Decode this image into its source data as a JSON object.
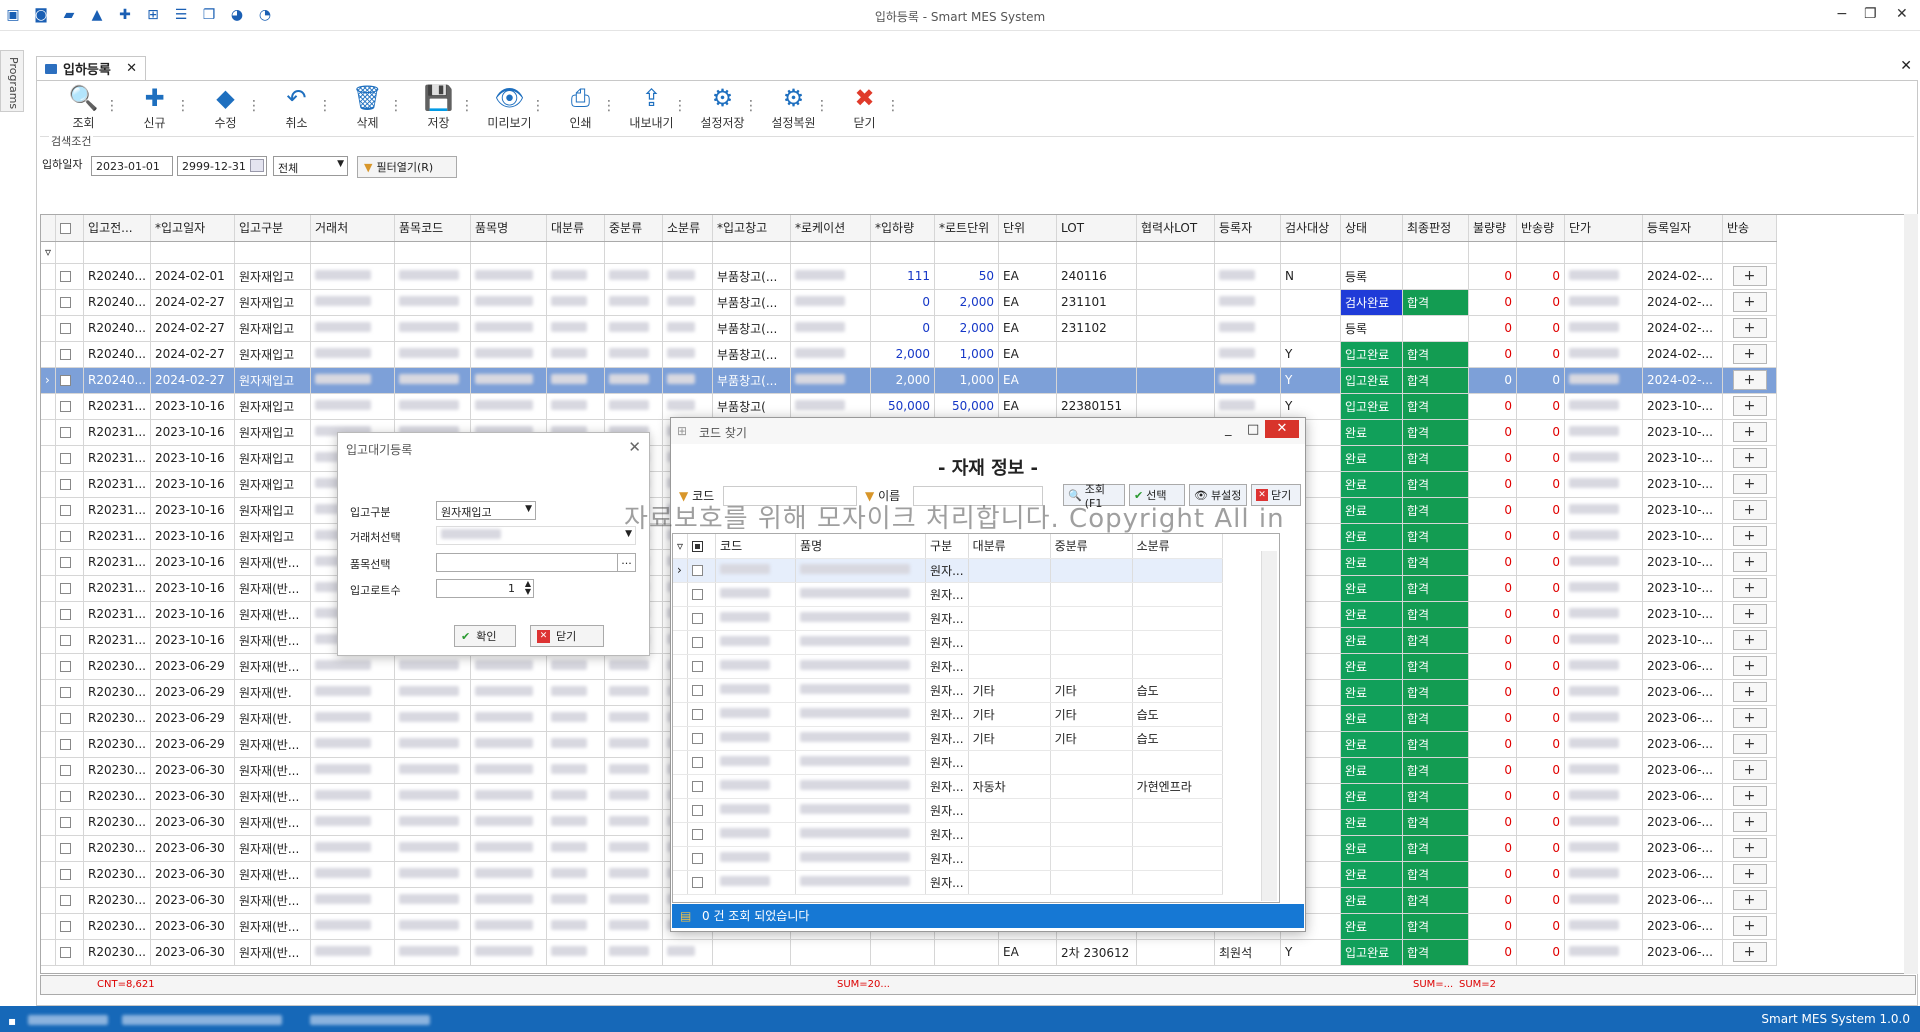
{
  "window": {
    "title": "입하등록 - Smart MES System"
  },
  "quick_icons": [
    "monitor-icon",
    "camera-icon",
    "folder-icon",
    "lock-icon",
    "add-circle-icon",
    "hierarchy-icon",
    "list-icon",
    "window-icon",
    "palette-icon",
    "palette-icon"
  ],
  "sidebar": {
    "label": "Programs"
  },
  "tab": {
    "label": "입하등록"
  },
  "toolbar": [
    {
      "label": "조회",
      "icon": "search-icon"
    },
    {
      "label": "신규",
      "icon": "new-icon"
    },
    {
      "label": "수정",
      "icon": "eraser-icon"
    },
    {
      "label": "취소",
      "icon": "undo-icon"
    },
    {
      "label": "삭제",
      "icon": "trash-icon"
    },
    {
      "label": "저장",
      "icon": "save-icon"
    },
    {
      "label": "미리보기",
      "icon": "eye-icon"
    },
    {
      "label": "인쇄",
      "icon": "print-icon"
    },
    {
      "label": "내보내기",
      "icon": "export-icon"
    },
    {
      "label": "설정저장",
      "icon": "gear-icon"
    },
    {
      "label": "설정복원",
      "icon": "gear-restore-icon"
    },
    {
      "label": "닫기",
      "icon": "close-icon"
    }
  ],
  "filter": {
    "legend": "검색조건",
    "date_label": "입하일자",
    "date_from": "2023-01-01",
    "date_to": "2999-12-31",
    "type_value": "전체",
    "filter_button": "필터열기(R)"
  },
  "grid": {
    "columns": [
      "",
      "입고전...",
      "*입고일자",
      "입고구분",
      "거래처",
      "품목코드",
      "품목명",
      "대분류",
      "중분류",
      "소분류",
      "*입고창고",
      "*로케이션",
      "*입하량",
      "*로트단위",
      "단위",
      "LOT",
      "협력사LOT",
      "등록자",
      "검사대상",
      "상태",
      "최종판정",
      "불량량",
      "반송량",
      "단가",
      "등록일자",
      "반송"
    ],
    "rows": [
      {
        "no": "R20240...",
        "date": "2024-02-01",
        "type": "원자재입고",
        "wh": "부품창고(...",
        "qty": "111",
        "lot_unit": "50",
        "unit": "EA",
        "lot": "240116",
        "insp": "N",
        "status": "등록",
        "judge": "",
        "bad": "0",
        "ret": "0",
        "reg": "2024-02-..."
      },
      {
        "no": "R20240...",
        "date": "2024-02-27",
        "type": "원자재입고",
        "wh": "부품창고(...",
        "qty": "0",
        "lot_unit": "2,000",
        "unit": "EA",
        "lot": "231101",
        "insp": "",
        "status": "검사완료",
        "judge": "합격",
        "bad": "0",
        "ret": "0",
        "reg": "2024-02-..."
      },
      {
        "no": "R20240...",
        "date": "2024-02-27",
        "type": "원자재입고",
        "wh": "부품창고(...",
        "qty": "0",
        "lot_unit": "2,000",
        "unit": "EA",
        "lot": "231102",
        "insp": "",
        "status": "등록",
        "judge": "",
        "bad": "0",
        "ret": "0",
        "reg": "2024-02-..."
      },
      {
        "no": "R20240...",
        "date": "2024-02-27",
        "type": "원자재입고",
        "wh": "부품창고(...",
        "qty": "2,000",
        "lot_unit": "1,000",
        "unit": "EA",
        "lot": "",
        "insp": "Y",
        "status": "입고완료",
        "judge": "합격",
        "bad": "0",
        "ret": "0",
        "reg": "2024-02-..."
      },
      {
        "no": "R20240...",
        "date": "2024-02-27",
        "type": "원자재입고",
        "wh": "부품창고(...",
        "qty": "2,000",
        "lot_unit": "1,000",
        "unit": "EA",
        "lot": "",
        "insp": "Y",
        "status": "입고완료",
        "judge": "합격",
        "bad": "0",
        "ret": "0",
        "reg": "2024-02-...",
        "selected": true
      },
      {
        "no": "R20231...",
        "date": "2023-10-16",
        "type": "원자재입고",
        "wh": "부품창고(",
        "qty": "50,000",
        "lot_unit": "50,000",
        "unit": "EA",
        "lot": "22380151",
        "insp": "Y",
        "status": "입고완료",
        "judge": "합격",
        "bad": "0",
        "ret": "0",
        "reg": "2023-10-..."
      },
      {
        "no": "R20231...",
        "date": "2023-10-16",
        "type": "원자재입고",
        "wh": "",
        "qty": "",
        "lot_unit": "",
        "unit": "",
        "lot": "",
        "insp": "",
        "status": "완료",
        "judge": "합격",
        "bad": "0",
        "ret": "0",
        "reg": "2023-10-..."
      },
      {
        "no": "R20231...",
        "date": "2023-10-16",
        "type": "원자재입고",
        "wh": "",
        "qty": "",
        "lot_unit": "",
        "unit": "",
        "lot": "",
        "insp": "",
        "status": "완료",
        "judge": "합격",
        "bad": "0",
        "ret": "0",
        "reg": "2023-10-..."
      },
      {
        "no": "R20231...",
        "date": "2023-10-16",
        "type": "원자재입고",
        "wh": "",
        "qty": "",
        "lot_unit": "",
        "unit": "",
        "lot": "",
        "insp": "",
        "status": "완료",
        "judge": "합격",
        "bad": "0",
        "ret": "0",
        "reg": "2023-10-..."
      },
      {
        "no": "R20231...",
        "date": "2023-10-16",
        "type": "원자재입고",
        "wh": "",
        "qty": "",
        "lot_unit": "",
        "unit": "",
        "lot": "",
        "insp": "",
        "status": "완료",
        "judge": "합격",
        "bad": "0",
        "ret": "0",
        "reg": "2023-10-..."
      },
      {
        "no": "R20231...",
        "date": "2023-10-16",
        "type": "원자재입고",
        "wh": "",
        "qty": "",
        "lot_unit": "",
        "unit": "",
        "lot": "",
        "insp": "",
        "status": "완료",
        "judge": "합격",
        "bad": "0",
        "ret": "0",
        "reg": "2023-10-..."
      },
      {
        "no": "R20231...",
        "date": "2023-10-16",
        "type": "원자재(반...",
        "wh": "",
        "qty": "",
        "lot_unit": "",
        "unit": "",
        "lot": "",
        "insp": "",
        "status": "완료",
        "judge": "합격",
        "bad": "0",
        "ret": "0",
        "reg": "2023-10-..."
      },
      {
        "no": "R20231...",
        "date": "2023-10-16",
        "type": "원자재(반...",
        "wh": "",
        "qty": "",
        "lot_unit": "",
        "unit": "",
        "lot": "",
        "insp": "",
        "status": "완료",
        "judge": "합격",
        "bad": "0",
        "ret": "0",
        "reg": "2023-10-..."
      },
      {
        "no": "R20231...",
        "date": "2023-10-16",
        "type": "원자재(반...",
        "wh": "",
        "qty": "",
        "lot_unit": "",
        "unit": "",
        "lot": "",
        "insp": "",
        "status": "완료",
        "judge": "합격",
        "bad": "0",
        "ret": "0",
        "reg": "2023-10-..."
      },
      {
        "no": "R20231...",
        "date": "2023-10-16",
        "type": "원자재(반...",
        "wh": "",
        "qty": "",
        "lot_unit": "",
        "unit": "",
        "lot": "",
        "insp": "",
        "status": "완료",
        "judge": "합격",
        "bad": "0",
        "ret": "0",
        "reg": "2023-10-..."
      },
      {
        "no": "R20230...",
        "date": "2023-06-29",
        "type": "원자재(반...",
        "wh": "",
        "qty": "",
        "lot_unit": "",
        "unit": "",
        "lot": "",
        "insp": "",
        "status": "완료",
        "judge": "합격",
        "bad": "0",
        "ret": "0",
        "reg": "2023-06-..."
      },
      {
        "no": "R20230...",
        "date": "2023-06-29",
        "type": "원자재(반.",
        "wh": "",
        "qty": "",
        "lot_unit": "",
        "unit": "",
        "lot": "",
        "insp": "",
        "status": "완료",
        "judge": "합격",
        "bad": "0",
        "ret": "0",
        "reg": "2023-06-..."
      },
      {
        "no": "R20230...",
        "date": "2023-06-29",
        "type": "원자재(반.",
        "wh": "",
        "qty": "",
        "lot_unit": "",
        "unit": "",
        "lot": "",
        "insp": "",
        "status": "완료",
        "judge": "합격",
        "bad": "0",
        "ret": "0",
        "reg": "2023-06-..."
      },
      {
        "no": "R20230...",
        "date": "2023-06-29",
        "type": "원자재(반...",
        "wh": "",
        "qty": "",
        "lot_unit": "",
        "unit": "",
        "lot": "",
        "insp": "",
        "status": "완료",
        "judge": "합격",
        "bad": "0",
        "ret": "0",
        "reg": "2023-06-..."
      },
      {
        "no": "R20230...",
        "date": "2023-06-30",
        "type": "원자재(반...",
        "wh": "",
        "qty": "",
        "lot_unit": "",
        "unit": "",
        "lot": "",
        "insp": "",
        "status": "완료",
        "judge": "합격",
        "bad": "0",
        "ret": "0",
        "reg": "2023-06-..."
      },
      {
        "no": "R20230...",
        "date": "2023-06-30",
        "type": "원자재(반...",
        "wh": "",
        "qty": "",
        "lot_unit": "",
        "unit": "",
        "lot": "",
        "insp": "",
        "status": "완료",
        "judge": "합격",
        "bad": "0",
        "ret": "0",
        "reg": "2023-06-..."
      },
      {
        "no": "R20230...",
        "date": "2023-06-30",
        "type": "원자재(반...",
        "wh": "",
        "qty": "",
        "lot_unit": "",
        "unit": "",
        "lot": "",
        "insp": "",
        "status": "완료",
        "judge": "합격",
        "bad": "0",
        "ret": "0",
        "reg": "2023-06-..."
      },
      {
        "no": "R20230...",
        "date": "2023-06-30",
        "type": "원자재(반...",
        "wh": "",
        "qty": "",
        "lot_unit": "",
        "unit": "",
        "lot": "",
        "insp": "",
        "status": "완료",
        "judge": "합격",
        "bad": "0",
        "ret": "0",
        "reg": "2023-06-..."
      },
      {
        "no": "R20230...",
        "date": "2023-06-30",
        "type": "원자재(반...",
        "wh": "",
        "qty": "",
        "lot_unit": "",
        "unit": "",
        "lot": "",
        "insp": "",
        "status": "완료",
        "judge": "합격",
        "bad": "0",
        "ret": "0",
        "reg": "2023-06-..."
      },
      {
        "no": "R20230...",
        "date": "2023-06-30",
        "type": "원자재(반...",
        "wh": "",
        "qty": "",
        "lot_unit": "",
        "unit": "",
        "lot": "",
        "insp": "",
        "status": "완료",
        "judge": "합격",
        "bad": "0",
        "ret": "0",
        "reg": "2023-06-..."
      },
      {
        "no": "R20230...",
        "date": "2023-06-30",
        "type": "원자재(반...",
        "wh": "",
        "qty": "",
        "lot_unit": "",
        "unit": "",
        "lot": "",
        "insp": "",
        "status": "완료",
        "judge": "합격",
        "bad": "0",
        "ret": "0",
        "reg": "2023-06-..."
      },
      {
        "no": "R20230...",
        "date": "2023-06-30",
        "type": "원자재(반...",
        "wh": "",
        "qty": "",
        "lot_unit": "",
        "unit": "EA",
        "lot": "2차 230612",
        "user": "최원석",
        "insp": "Y",
        "status": "입고완료",
        "judge": "합격",
        "bad": "0",
        "ret": "0",
        "reg": "2023-06-..."
      }
    ],
    "plus_label": "+"
  },
  "footer": {
    "cnt": "CNT=8,621",
    "sum_qty": "SUM=20...",
    "sum_bad": "SUM=...",
    "sum_ret": "SUM=2"
  },
  "dialog_wait": {
    "title": "입고대기등록",
    "type_label": "입고구분",
    "type_value": "원자재입고",
    "vendor_label": "거래처선택",
    "item_label": "품목선택",
    "ellipsis": "...",
    "lot_label": "입고로트수",
    "lot_value": "1",
    "ok": "확인",
    "close": "닫기"
  },
  "dialog_code": {
    "title": "코드 찾기",
    "heading": "- 자재 정보 -",
    "code_label": "코드",
    "name_label": "이름",
    "btn_search": "조회(F1",
    "btn_select": "선택",
    "btn_view": "뷰설정",
    "btn_close": "닫기",
    "columns": [
      "",
      "",
      "코드",
      "품명",
      "구분",
      "대분류",
      "중분류",
      "소분류"
    ],
    "rows": [
      {
        "kind": "원자...",
        "c1": "",
        "c2": "",
        "c3": ""
      },
      {
        "kind": "원자...",
        "c1": "",
        "c2": "",
        "c3": ""
      },
      {
        "kind": "원자...",
        "c1": "",
        "c2": "",
        "c3": ""
      },
      {
        "kind": "원자...",
        "c1": "",
        "c2": "",
        "c3": ""
      },
      {
        "kind": "원자...",
        "c1": "",
        "c2": "",
        "c3": ""
      },
      {
        "kind": "원자...",
        "c1": "기타",
        "c2": "기타",
        "c3": "습도"
      },
      {
        "kind": "원자...",
        "c1": "기타",
        "c2": "기타",
        "c3": "습도"
      },
      {
        "kind": "원자...",
        "c1": "기타",
        "c2": "기타",
        "c3": "습도"
      },
      {
        "kind": "원자...",
        "c1": "",
        "c2": "",
        "c3": ""
      },
      {
        "kind": "원자...",
        "c1": "자동차",
        "c2": "",
        "c3": "가현엔프라"
      },
      {
        "kind": "원자...",
        "c1": "",
        "c2": "",
        "c3": ""
      },
      {
        "kind": "원자...",
        "c1": "",
        "c2": "",
        "c3": ""
      },
      {
        "kind": "원자...",
        "c1": "",
        "c2": "",
        "c3": ""
      },
      {
        "kind": "원자...",
        "c1": "",
        "c2": "",
        "c3": ""
      }
    ],
    "status": "0 건 조회 되었습니다"
  },
  "watermark": "자료보호를 위해 모자이크 처리합니다. Copyright All in",
  "statusbar": {
    "app": "Smart MES System 1.0.0"
  }
}
